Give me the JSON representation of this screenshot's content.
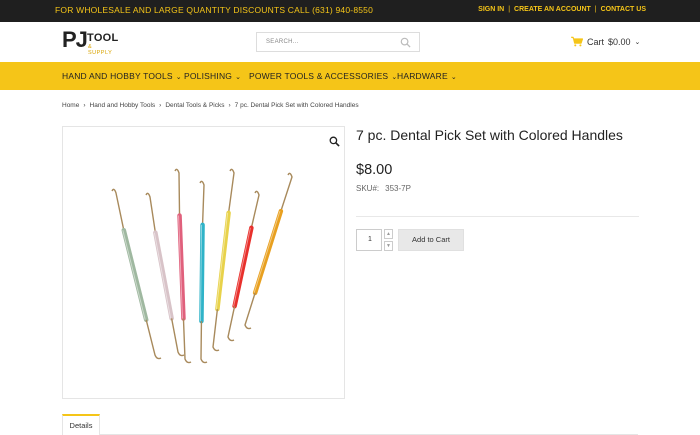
{
  "topbar": {
    "promo": "FOR WHOLESALE AND LARGE QUANTITY DISCOUNTS CALL (631) 940-8550",
    "links": [
      "SIGN IN",
      "CREATE AN ACCOUNT",
      "CONTACT US"
    ]
  },
  "header": {
    "logo_main": "PJ",
    "logo_tool": "TOOL",
    "logo_supply": "& SUPPLY",
    "search_placeholder": "SEARCH...",
    "cart_label": "Cart",
    "cart_total": "$0.00"
  },
  "nav": {
    "items": [
      "HAND AND HOBBY TOOLS",
      "POLISHING",
      "POWER TOOLS & ACCESSORIES",
      "HARDWARE"
    ]
  },
  "breadcrumb": [
    "Home",
    "Hand and Hobby Tools",
    "Dental Tools & Picks",
    "7 pc. Dental Pick Set with Colored Handles"
  ],
  "product": {
    "title": "7 pc. Dental Pick Set with Colored Handles",
    "price": "$8.00",
    "sku_label": "SKU#:",
    "sku": "353-7P",
    "quantity": "1",
    "add_to_cart": "Add to Cart",
    "handle_colors": [
      "#9fb8a0",
      "#d8c3c8",
      "#e0607c",
      "#2fb3c8",
      "#e8d24a",
      "#e8302c",
      "#e8a020"
    ]
  },
  "tabs": [
    "Details"
  ],
  "colors": {
    "accent": "#f5c518",
    "topbar": "#1f1f1f"
  }
}
